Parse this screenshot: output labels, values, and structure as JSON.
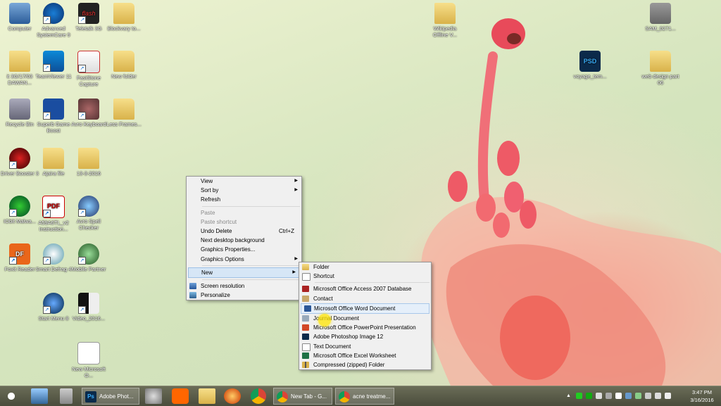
{
  "desktop_icons": [
    {
      "label": "Computer",
      "icon": "computer-icon"
    },
    {
      "label": "Advanced SystemCare 9",
      "icon": "advanced-systemcare-icon"
    },
    {
      "label": "Teletalk 3G",
      "icon": "flash-icon",
      "badge": "flash"
    },
    {
      "label": "Blockvary to...",
      "icon": "folder-icon"
    },
    {
      "label": "it 3G/17/03 DAWAN...",
      "icon": "folder-icon"
    },
    {
      "label": "TeamViewer 11",
      "icon": "teamviewer-icon"
    },
    {
      "label": "FastStone Capture",
      "icon": "faststone-icon"
    },
    {
      "label": "New folder",
      "icon": "folder-icon"
    },
    {
      "label": "Recycle Bin",
      "icon": "recycle-bin-icon"
    },
    {
      "label": "Superb Game Boost",
      "icon": "rocket-icon"
    },
    {
      "label": "Avro Keyboard",
      "icon": "avro-keyboard-icon"
    },
    {
      "label": "Less Frames...",
      "icon": "folder-icon"
    },
    {
      "label": "Driver Booster 3",
      "icon": "driver-booster-icon"
    },
    {
      "label": "Ajaira file",
      "icon": "folder-icon"
    },
    {
      "label": "13-3-2016",
      "icon": "folder-icon"
    },
    {
      "label": "IObit Malwa...",
      "icon": "iobit-malware-icon"
    },
    {
      "label": "A59A6TL_v2 Instruction...",
      "icon": "pdf-icon",
      "badge": "PDF"
    },
    {
      "label": "Avro Spell Checker",
      "icon": "spell-checker-icon"
    },
    {
      "label": "Foxit Reader",
      "icon": "foxit-reader-icon",
      "badge": "DF"
    },
    {
      "label": "Smart Defrag 4",
      "icon": "smart-defrag-icon"
    },
    {
      "label": "Mobile Partner",
      "icon": "mobile-partner-icon"
    },
    {
      "label": "Start Menu 8",
      "icon": "start-menu-icon"
    },
    {
      "label": "Video_2016...",
      "icon": "video-icon"
    },
    {
      "label": "New Microsoft O...",
      "icon": "word-doc-icon"
    },
    {
      "label": "Wikipedia Offline V...",
      "icon": "folder-icon"
    },
    {
      "label": "SAM_0271...",
      "icon": "image-icon"
    },
    {
      "label": "voyage_tem...",
      "icon": "psd-icon",
      "badge": "PSD"
    },
    {
      "label": "web design part 06",
      "icon": "folder-icon"
    }
  ],
  "context_menu": {
    "items": [
      {
        "label": "View",
        "disabled": false,
        "submenu": true
      },
      {
        "label": "Sort by",
        "disabled": false,
        "submenu": true
      },
      {
        "label": "Refresh",
        "disabled": false
      },
      {
        "label": "Paste",
        "disabled": true
      },
      {
        "label": "Paste shortcut",
        "disabled": true
      },
      {
        "label": "Undo Delete",
        "shortcut": "Ctrl+Z",
        "disabled": false
      },
      {
        "label": "Next desktop background",
        "disabled": false
      },
      {
        "label": "Graphics Properties...",
        "disabled": false
      },
      {
        "label": "Graphics Options",
        "disabled": false,
        "submenu": true
      },
      {
        "label": "New",
        "disabled": false,
        "submenu": true,
        "active": true
      },
      {
        "label": "Screen resolution",
        "disabled": false,
        "icon": "screen-resolution-icon"
      },
      {
        "label": "Personalize",
        "disabled": false,
        "icon": "personalize-icon"
      }
    ]
  },
  "new_submenu": {
    "items": [
      {
        "label": "Folder",
        "icon": "folder-icon"
      },
      {
        "label": "Shortcut",
        "icon": "shortcut-icon"
      },
      {
        "label": "Microsoft Office Access 2007 Database",
        "icon": "access-icon"
      },
      {
        "label": "Contact",
        "icon": "contact-icon"
      },
      {
        "label": "Microsoft Office Word Document",
        "icon": "word-icon",
        "hover": true
      },
      {
        "label": "Journal Document",
        "icon": "journal-icon"
      },
      {
        "label": "Microsoft Office PowerPoint Presentation",
        "icon": "powerpoint-icon"
      },
      {
        "label": "Adobe Photoshop Image 12",
        "icon": "photoshop-icon"
      },
      {
        "label": "Text Document",
        "icon": "text-document-icon"
      },
      {
        "label": "Microsoft Office Excel Worksheet",
        "icon": "excel-icon"
      },
      {
        "label": "Compressed (zipped) Folder",
        "icon": "zip-folder-icon"
      }
    ]
  },
  "taskbar": {
    "tasks": [
      {
        "label": "Adobe Phot...",
        "icon": "photoshop-icon",
        "badge": "Ps"
      },
      {
        "label": "New Tab - G...",
        "icon": "chrome-icon"
      },
      {
        "label": "acne treatme...",
        "icon": "chrome-icon"
      }
    ],
    "clock": {
      "time": "3:47 PM",
      "date": "3/16/2016"
    }
  },
  "colors": {
    "menu_bg": "#f0f0f0",
    "menu_active": "#d6e6f6",
    "taskbar": "#55574a"
  }
}
